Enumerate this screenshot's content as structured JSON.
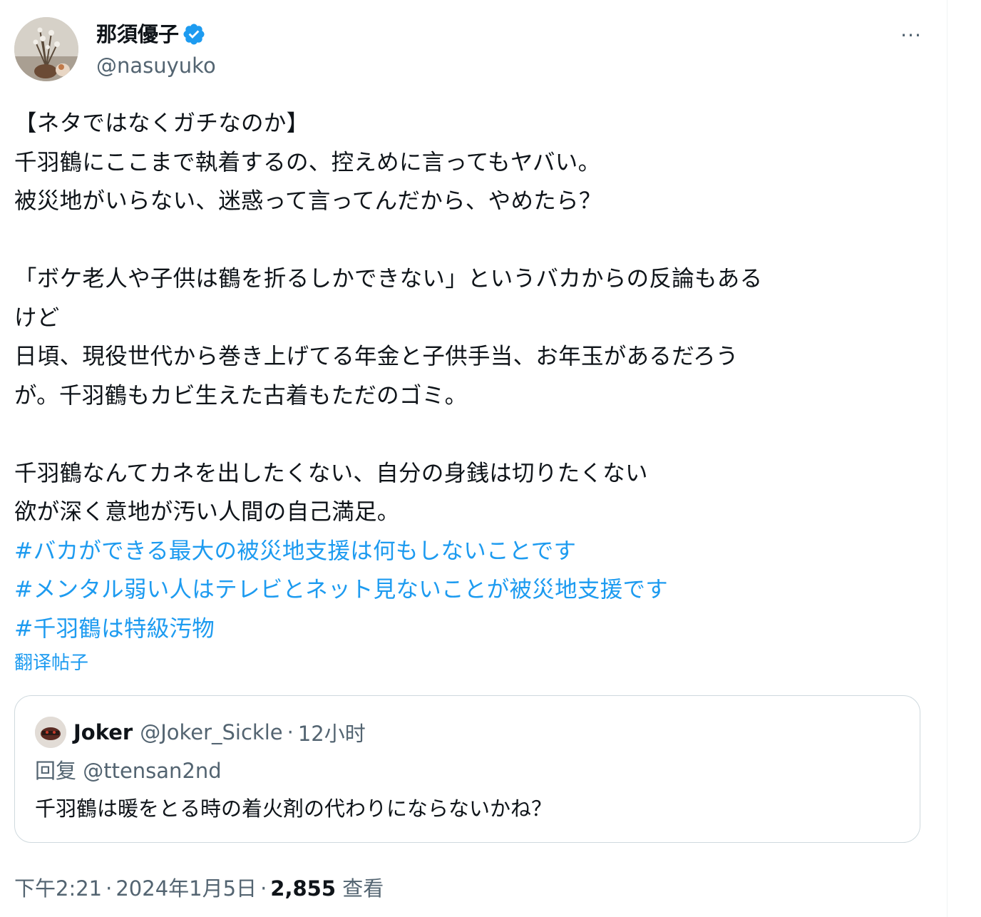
{
  "author": {
    "display_name": "那須優子",
    "handle": "@nasuyuko",
    "verified": true
  },
  "more_button": "···",
  "tweet": {
    "lines": [
      "【ネタではなくガチなのか】",
      "千羽鶴にここまで執着するの、控えめに言ってもヤバい。",
      "被災地がいらない、迷惑って言ってんだから、やめたら？",
      "",
      "「ボケ老人や子供は鶴を折るしかできない」というバカからの反論もある",
      "けど",
      "日頃、現役世代から巻き上げてる年金と子供手当、お年玉があるだろう",
      "が。千羽鶴もカビ生えた古着もただのゴミ。",
      "",
      "千羽鶴なんてカネを出したくない、自分の身銭は切りたくない",
      "欲が深く意地が汚い人間の自己満足。"
    ],
    "hashtags": [
      "#バカができる最大の被災地支援は何もしないことです",
      "#メンタル弱い人はテレビとネット見ないことが被災地支援です",
      "#千羽鶴は特級汚物"
    ],
    "translate_label": "翻译帖子"
  },
  "quote": {
    "name": "Joker",
    "handle": "@Joker_Sickle",
    "dot": "·",
    "time": "12小时",
    "reply_to": "回复 @ttensan2nd",
    "text": "千羽鶴は暖をとる時の着火剤の代わりにならないかね？"
  },
  "footer": {
    "time": "下午2:21",
    "dot1": "·",
    "date": "2024年1月5日",
    "dot2": "·",
    "views_count": "2,855",
    "views_label": "查看"
  },
  "colors": {
    "link": "#1d9bf0",
    "secondary_text": "#536471",
    "primary_text": "#0f1419",
    "border": "#cfd9de",
    "verified": "#1d9bf0"
  }
}
